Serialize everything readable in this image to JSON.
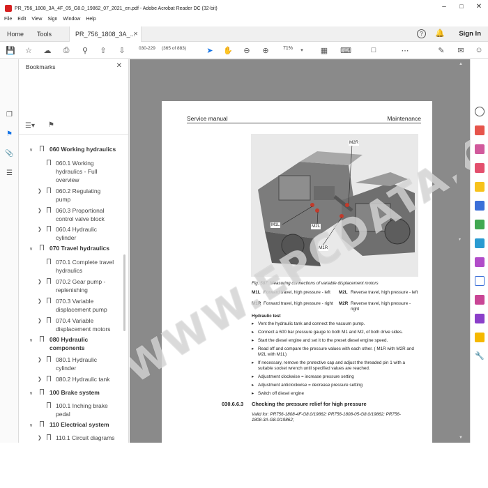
{
  "window": {
    "title": "PR_756_1808_3A_4F_05_G8.0_19862_07_2021_en.pdf - Adobe Acrobat Reader DC (32-bit)",
    "menu": [
      "File",
      "Edit",
      "View",
      "Sign",
      "Window",
      "Help"
    ]
  },
  "tabs": {
    "home": "Home",
    "tools": "Tools",
    "doc": "PR_756_1808_3A_...",
    "signin": "Sign In"
  },
  "toolbar": {
    "page_label": "030-229",
    "page_of": "(365 of 883)",
    "zoom": "71%"
  },
  "bookmarks": {
    "heading": "Bookmarks",
    "items": [
      {
        "label": "060 Working hydraulics",
        "bold": true
      },
      {
        "label": "060.1 Working hydraulics - Full overview"
      },
      {
        "label": "060.2 Regulating pump"
      },
      {
        "label": "060.3 Proportional control valve block"
      },
      {
        "label": "060.4 Hydraulic cylinder"
      },
      {
        "label": "070 Travel hydraulics",
        "bold": true
      },
      {
        "label": "070.1 Complete travel hydraulics"
      },
      {
        "label": "070.2 Gear pump - replenishing"
      },
      {
        "label": "070.3 Variable displacement pump"
      },
      {
        "label": "070.4 Variable displacement motors"
      },
      {
        "label": "080 Hydraulic components",
        "bold": true
      },
      {
        "label": "080.1 Hydraulic cylinder"
      },
      {
        "label": "080.2 Hydraulic tank"
      },
      {
        "label": "100 Brake system",
        "bold": true
      },
      {
        "label": "100.1 Inching brake pedal"
      },
      {
        "label": "110 Electrical system",
        "bold": true
      },
      {
        "label": "110.1 Circuit diagrams"
      }
    ]
  },
  "page": {
    "header_left": "Service manual",
    "header_right": "Maintenance",
    "labels": [
      "M2R",
      "M1L",
      "M2L",
      "M1R"
    ],
    "fig_caption": "Fig. 587: Measuring connections of variable displacement motors",
    "legend": [
      {
        "code": "M1L",
        "text": "Forward travel, high pressure - left"
      },
      {
        "code": "M2L",
        "text": "Reverse travel, high pressure - left"
      },
      {
        "code": "M1R",
        "text": "Forward travel, high pressure - right"
      },
      {
        "code": "M2R",
        "text": "Reverse travel, high pressure - right"
      }
    ],
    "hydraulic_test": "Hydraulic test",
    "steps": [
      "Vent the hydraulic tank and connect the vacuum pump.",
      "Connect a 600 bar pressure gauge to both M1 and M2, of both drive sides.",
      "Start the diesel engine and set it to the preset diesel engine speed.",
      "Read off and compare the pressure values with each other. ( M1R with M2R and M2L with M1L)",
      "If necessary, remove the protective cap and adjust the threaded pin 1 with a suitable socket wrench until specified values are reached.",
      "Adjustment clockwise = increase pressure setting",
      "Adjustment anticlockwise = decrease pressure setting",
      "Switch off diesel engine"
    ],
    "section_num": "030.6.6.3",
    "section_title": "Checking the pressure relief for high pressure",
    "valid_for": "Valid for: PR756-1808-4F-G8.0/19862; PR756-1808-05-G8.0/19862; PR756-1808-3A-G8.0/19862;",
    "watermark": "WWW.EPCDATA.COM"
  }
}
